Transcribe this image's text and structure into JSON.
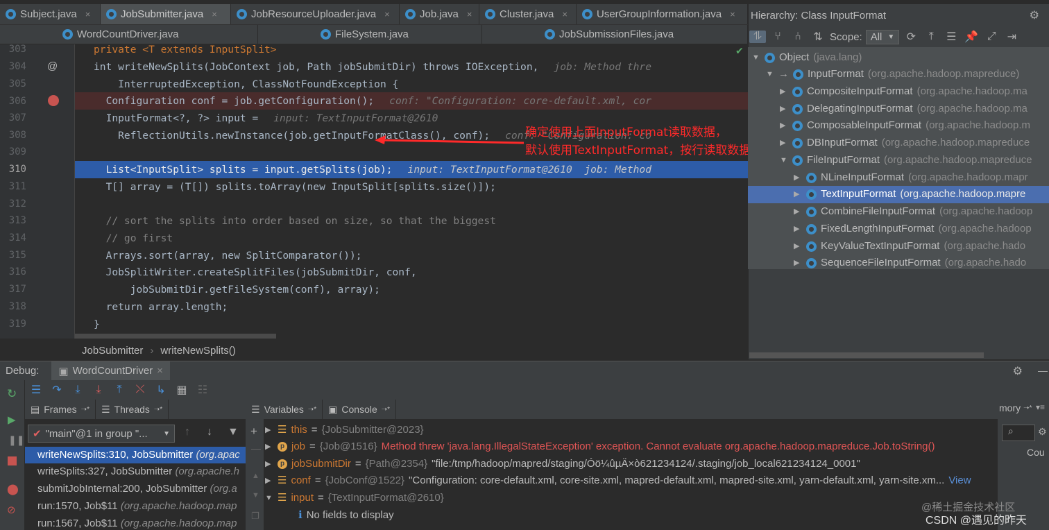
{
  "tabs_row1": [
    {
      "label": "Subject.java",
      "close": "×"
    },
    {
      "label": "JobSubmitter.java",
      "close": "×",
      "active": true
    },
    {
      "label": "JobResourceUploader.java",
      "close": "×"
    },
    {
      "label": "Job.java",
      "close": "×"
    },
    {
      "label": "Cluster.java",
      "close": "×"
    },
    {
      "label": "UserGroupInformation.java",
      "close": "×"
    }
  ],
  "tabs_row2": [
    {
      "label": "WordCountDriver.java"
    },
    {
      "label": "FileSystem.java"
    },
    {
      "label": "JobSubmissionFiles.java"
    }
  ],
  "code_lines": [
    {
      "n": "303",
      "text": "private <T extends InputSplit>"
    },
    {
      "n": "304",
      "text": "int writeNewSplits(JobContext job, Path jobSubmitDir) throws IOException,",
      "hint": "job: Method thre"
    },
    {
      "n": "305",
      "text": "    InterruptedException, ClassNotFoundException {"
    },
    {
      "n": "306",
      "text": "  Configuration conf = job.getConfiguration();",
      "hint": "conf: \"Configuration: core-default.xml, cor"
    },
    {
      "n": "307",
      "text": "  InputFormat<?, ?> input =",
      "hint": "input: TextInputFormat@2610"
    },
    {
      "n": "308",
      "text": "    ReflectionUtils.newInstance(job.getInputFormatClass(), conf);",
      "hint": "conf: \"Configuration: co"
    },
    {
      "n": "309",
      "text": ""
    },
    {
      "n": "310",
      "text": "  List<InputSplit> splits = input.getSplits(job);",
      "hint": "input: TextInputFormat@2610  job: Method"
    },
    {
      "n": "311",
      "text": "  T[] array = (T[]) splits.toArray(new InputSplit[splits.size()]);"
    },
    {
      "n": "312",
      "text": ""
    },
    {
      "n": "313",
      "text": "  // sort the splits into order based on size, so that the biggest"
    },
    {
      "n": "314",
      "text": "  // go first"
    },
    {
      "n": "315",
      "text": "  Arrays.sort(array, new SplitComparator());"
    },
    {
      "n": "316",
      "text": "  JobSplitWriter.createSplitFiles(jobSubmitDir, conf,"
    },
    {
      "n": "317",
      "text": "      jobSubmitDir.getFileSystem(conf), array);"
    },
    {
      "n": "318",
      "text": "  return array.length;"
    },
    {
      "n": "319",
      "text": "}"
    }
  ],
  "breadcrumb": {
    "class": "JobSubmitter",
    "sep": "›",
    "method": "writeNewSplits()"
  },
  "annotation": {
    "line1": "确定使用上面InputFormat读取数据，",
    "line2": "默认使用TextInputFormat，按行读取数据"
  },
  "hierarchy": {
    "title": "Hierarchy:  Class InputFormat",
    "scope_label": "Scope:",
    "scope_value": "All",
    "items": [
      {
        "name": "Object",
        "pkg": "(java.lang)"
      },
      {
        "name": "InputFormat",
        "pkg": "(org.apache.hadoop.mapreduce)"
      },
      {
        "name": "CompositeInputFormat",
        "pkg": "(org.apache.hadoop.ma"
      },
      {
        "name": "DelegatingInputFormat",
        "pkg": "(org.apache.hadoop.ma"
      },
      {
        "name": "ComposableInputFormat",
        "pkg": "(org.apache.hadoop.m"
      },
      {
        "name": "DBInputFormat",
        "pkg": "(org.apache.hadoop.mapreduce"
      },
      {
        "name": "FileInputFormat",
        "pkg": "(org.apache.hadoop.mapreduce"
      },
      {
        "name": "NLineInputFormat",
        "pkg": "(org.apache.hadoop.mapr"
      },
      {
        "name": "TextInputFormat",
        "pkg": "(org.apache.hadoop.mapre"
      },
      {
        "name": "CombineFileInputFormat",
        "pkg": "(org.apache.hadoop"
      },
      {
        "name": "FixedLengthInputFormat",
        "pkg": "(org.apache.hadoop"
      },
      {
        "name": "KeyValueTextInputFormat",
        "pkg": "(org.apache.hado"
      },
      {
        "name": "SequenceFileInputFormat",
        "pkg": "(org.apache.hado"
      }
    ]
  },
  "debug": {
    "label": "Debug:",
    "config": "WordCountDriver",
    "frames_tab": "Frames",
    "threads_tab": "Threads",
    "variables_tab": "Variables",
    "console_tab": "Console",
    "memory_tab": "mory",
    "thread_select": "\"main\"@1 in group \"...",
    "frames": [
      {
        "m": "writeNewSplits:310, JobSubmitter",
        "p": "(org.apac"
      },
      {
        "m": "writeSplits:327, JobSubmitter",
        "p": "(org.apache.h"
      },
      {
        "m": "submitJobInternal:200, JobSubmitter",
        "p": "(org.a"
      },
      {
        "m": "run:1570, Job$11",
        "p": "(org.apache.hadoop.map"
      },
      {
        "m": "run:1567, Job$11",
        "p": "(org.apache.hadoop.map"
      }
    ],
    "variables": [
      {
        "name": "this",
        "type": "{JobSubmitter@2023}",
        "value": ""
      },
      {
        "name": "job",
        "type": "{Job@1516}",
        "value": "Method threw 'java.lang.IllegalStateException' exception. Cannot evaluate org.apache.hadoop.mapreduce.Job.toString()",
        "error": true
      },
      {
        "name": "jobSubmitDir",
        "type": "{Path@2354}",
        "value": "\"file:/tmp/hadoop/mapred/staging/Óö¼ûµÄ×ò621234124/.staging/job_local621234124_0001\""
      },
      {
        "name": "conf",
        "type": "{JobConf@1522}",
        "value": "\"Configuration: core-default.xml, core-site.xml, mapred-default.xml, mapred-site.xml, yarn-default.xml, yarn-site.xm...",
        "link": "View"
      },
      {
        "name": "input",
        "type": "{TextInputFormat@2610}",
        "value": ""
      }
    ],
    "no_fields": "No fields to display",
    "mem_col": "Cou"
  },
  "watermark": {
    "line1": "@稀土掘金技术社区",
    "line2": "CSDN @遇见的昨天"
  }
}
